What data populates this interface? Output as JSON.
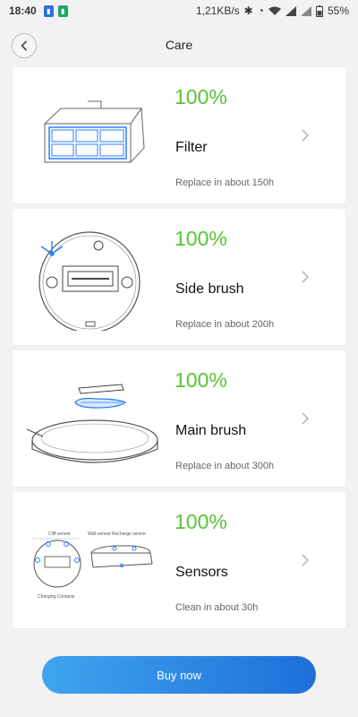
{
  "status_bar": {
    "time": "18:40",
    "net_speed": "1,21KB/s",
    "battery": "55%"
  },
  "header": {
    "title": "Care"
  },
  "items": [
    {
      "percent": "100%",
      "name": "Filter",
      "note": "Replace in about 150h",
      "icon": "filter-illustration"
    },
    {
      "percent": "100%",
      "name": "Side brush",
      "note": "Replace in about 200h",
      "icon": "side-brush-illustration"
    },
    {
      "percent": "100%",
      "name": "Main brush",
      "note": "Replace in about 300h",
      "icon": "main-brush-illustration"
    },
    {
      "percent": "100%",
      "name": "Sensors",
      "note": "Clean in about 30h",
      "icon": "sensors-illustration"
    }
  ],
  "sensor_labels": {
    "cliff": "Cliff sensor",
    "wall": "Wall sensor",
    "recharge": "Recharge sensor",
    "charging": "Charging Contacts"
  },
  "buy_button": {
    "label": "Buy now"
  },
  "colors": {
    "percent_green": "#5bc236",
    "button_start": "#3fa5ef",
    "button_end": "#1f6fd9",
    "filter_blue": "#2a7fff"
  }
}
